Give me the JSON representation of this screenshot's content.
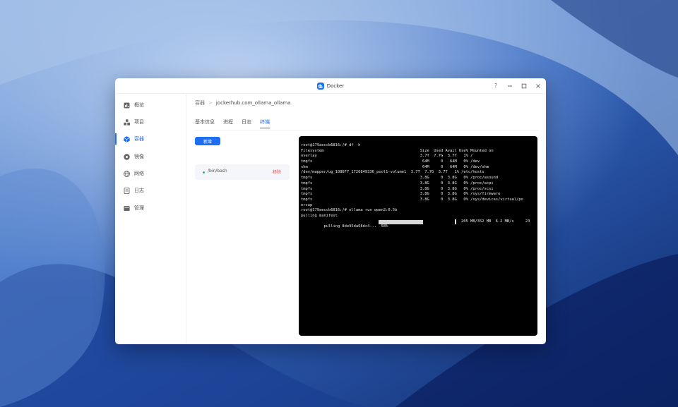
{
  "window": {
    "title": "Docker"
  },
  "sidebar": {
    "items": [
      {
        "label": "概览",
        "icon": "dashboard-icon"
      },
      {
        "label": "项目",
        "icon": "project-icon"
      },
      {
        "label": "容器",
        "icon": "container-icon",
        "active": true
      },
      {
        "label": "镜像",
        "icon": "image-icon"
      },
      {
        "label": "网络",
        "icon": "network-icon"
      },
      {
        "label": "日志",
        "icon": "log-icon"
      },
      {
        "label": "管理",
        "icon": "manage-icon"
      }
    ]
  },
  "breadcrumb": {
    "root": "容器",
    "separator": ">",
    "current": "jockerhub.com_ollama_ollama"
  },
  "tabs": [
    {
      "label": "基本信息"
    },
    {
      "label": "进程"
    },
    {
      "label": "日志"
    },
    {
      "label": "终端",
      "active": true
    }
  ],
  "actions": {
    "new_label": "新增"
  },
  "session": {
    "path": "/bin/bash",
    "remove_label": "移除",
    "status_color": "#19c37d"
  },
  "terminal": {
    "lines": [
      "root@179aeccb6816:/# df -h",
      "Filesystem                                          Size  Used Avail Use% Mounted on",
      "overlay                                             3.7T  7.7G  3.7T   1% /",
      "tmpfs                                                64M     0   64M   0% /dev",
      "shm                                                  64M     0   64M   0% /dev/shm",
      "/dev/mapper/ug_1086F7_1726849336_pool1-volume1  3.7T  7.7G  3.7T   1% /etc/hosts",
      "tmpfs                                               3.8G     0  3.8G   0% /proc/asound",
      "tmpfs                                               3.8G     0  3.8G   0% /proc/acpi",
      "tmpfs                                               3.8G     0  3.8G   0% /proc/scsi",
      "tmpfs                                               3.8G     0  3.8G   0% /sys/firmware",
      "tmpfs                                               3.8G     0  3.8G   0% /sys/devices/virtual/po",
      "ercap",
      "root@179aeccb6816:/# ollama run qwen2:0.5b",
      "pulling manifest"
    ],
    "progress": {
      "prefix": "pulling 8de95da68dc4...  58%",
      "percent": 58,
      "stats": "205 MB/352 MB  6.2 MB/s     23"
    }
  },
  "colors": {
    "accent": "#1d6ef0",
    "danger": "#ee4b4b",
    "terminal_bg": "#000000"
  }
}
